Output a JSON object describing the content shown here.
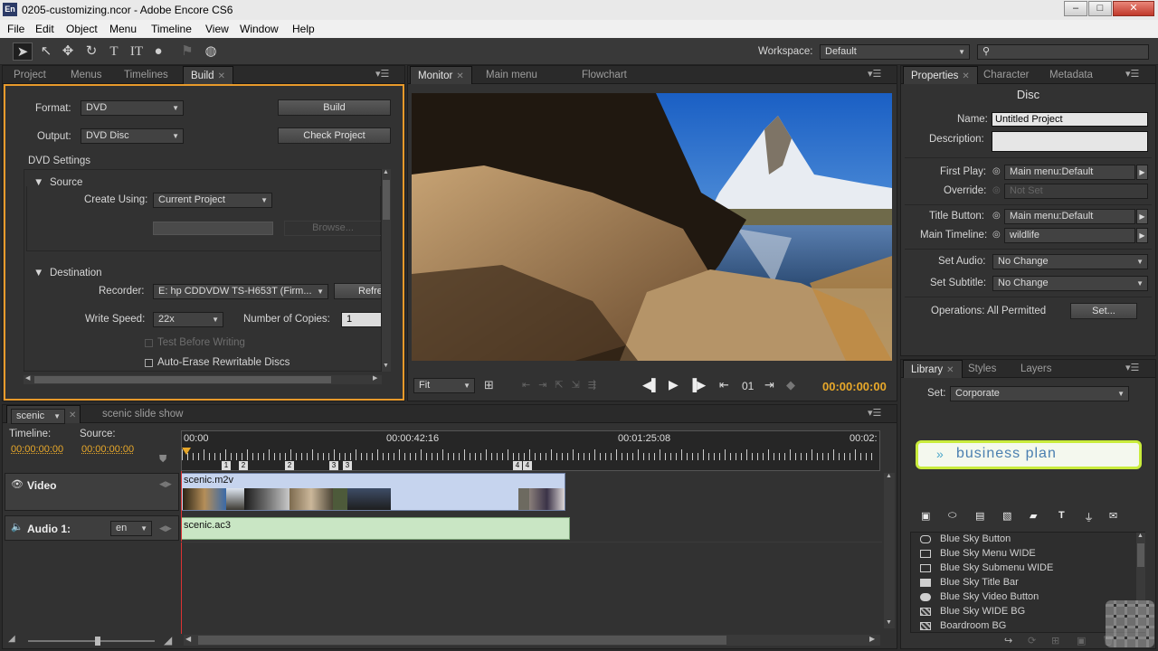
{
  "window": {
    "app_icon": "En",
    "title": "0205-customizing.ncor - Adobe Encore CS6",
    "buttons": [
      "minimize",
      "maximize",
      "close"
    ]
  },
  "menu": [
    "File",
    "Edit",
    "Object",
    "Menu",
    "Timeline",
    "View",
    "Window",
    "Help"
  ],
  "toolbar": {
    "tools": [
      "selection-tool",
      "direct-select-tool",
      "move-tool",
      "rotate-tool",
      "text-tool",
      "vertical-text-tool",
      "preview-tool",
      "link-tool",
      "globe-tool"
    ],
    "workspace_label": "Workspace:",
    "workspace_value": "Default",
    "search_placeholder": ""
  },
  "left_panel": {
    "tabs": [
      "Project",
      "Menus",
      "Timelines",
      "Build"
    ],
    "active_tab": "Build",
    "format_label": "Format:",
    "format_value": "DVD",
    "output_label": "Output:",
    "output_value": "DVD Disc",
    "build_button": "Build",
    "check_button": "Check Project",
    "dvd_settings": "DVD Settings",
    "source_header": "Source",
    "create_using_label": "Create Using:",
    "create_using_value": "Current Project",
    "browse_button": "Browse...",
    "destination_header": "Destination",
    "recorder_label": "Recorder:",
    "recorder_value": "E: hp  CDDVDW TS-H653T (Firm...",
    "refresh_button": "Refre",
    "write_speed_label": "Write Speed:",
    "write_speed_value": "22x",
    "copies_label": "Number of Copies:",
    "copies_value": "1",
    "test_label": "Test Before Writing",
    "auto_erase_label": "Auto-Erase Rewritable Discs"
  },
  "monitor": {
    "tabs": [
      "Monitor",
      "Main menu",
      "Flowchart"
    ],
    "zoom_value": "Fit",
    "chapter": "01",
    "timecode": "00:00:00:00"
  },
  "properties": {
    "tabs": [
      "Properties",
      "Character",
      "Metadata"
    ],
    "section": "Disc",
    "name_label": "Name:",
    "name_value": "Untitled Project",
    "description_label": "Description:",
    "first_play_label": "First Play:",
    "first_play_value": "Main menu:Default",
    "override_label": "Override:",
    "override_value": "Not Set",
    "title_button_label": "Title Button:",
    "title_button_value": "Main menu:Default",
    "main_timeline_label": "Main Timeline:",
    "main_timeline_value": "wildlife",
    "set_audio_label": "Set Audio:",
    "set_audio_value": "No Change",
    "set_subtitle_label": "Set Subtitle:",
    "set_subtitle_value": "No Change",
    "operations_label": "Operations: All Permitted",
    "set_button": "Set..."
  },
  "library": {
    "tabs": [
      "Library",
      "Styles",
      "Layers"
    ],
    "set_label": "Set:",
    "set_value": "Corporate",
    "preview_text": "business plan",
    "items": [
      "Blue Sky Button",
      "Blue Sky Menu WIDE",
      "Blue Sky Submenu WIDE",
      "Blue Sky Title Bar",
      "Blue Sky Video Button",
      "Blue Sky WIDE BG",
      "Boardroom BG"
    ]
  },
  "timeline": {
    "tabs": [
      "scenic",
      "scenic slide show"
    ],
    "timeline_label": "Timeline:",
    "timeline_tc": "00:00:00:00",
    "source_label": "Source:",
    "source_tc": "00:00:00:00",
    "ruler": [
      "00:00",
      "00:00:42:16",
      "00:01:25:08",
      "00:02:"
    ],
    "chapter_markers": [
      "1",
      "2",
      "3",
      "4"
    ],
    "video_track": "Video",
    "video_clip": "scenic.m2v",
    "audio_track": "Audio 1:",
    "audio_lang": "en",
    "audio_clip": "scenic.ac3"
  }
}
